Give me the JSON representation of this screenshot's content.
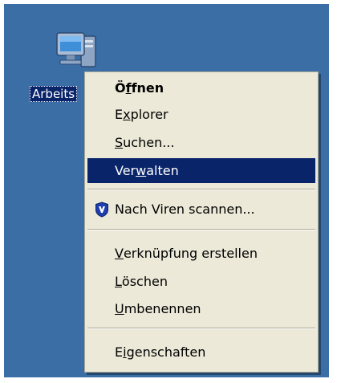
{
  "desktop": {
    "icon_label": "Arbeits"
  },
  "menu": {
    "open": {
      "pre": "Ö",
      "acc": "f",
      "post": "fnen"
    },
    "explorer": {
      "pre": "E",
      "acc": "x",
      "post": "plorer"
    },
    "search": {
      "pre": "",
      "acc": "S",
      "post": "uchen..."
    },
    "manage": {
      "pre": "Ver",
      "acc": "w",
      "post": "alten"
    },
    "virus_scan": {
      "label": "Nach Viren scannen...",
      "icon": "shield-icon"
    },
    "create_shortcut": {
      "pre": "",
      "acc": "V",
      "post": "erknüpfung erstellen"
    },
    "delete": {
      "pre": "",
      "acc": "L",
      "post": "öschen"
    },
    "rename": {
      "pre": "",
      "acc": "U",
      "post": "mbenennen"
    },
    "properties": {
      "pre": "E",
      "acc": "i",
      "post": "genschaften"
    }
  },
  "colors": {
    "desktop_background": "#3a6ea5",
    "highlight": "#0a246a",
    "menu_background": "#ece9d8"
  }
}
